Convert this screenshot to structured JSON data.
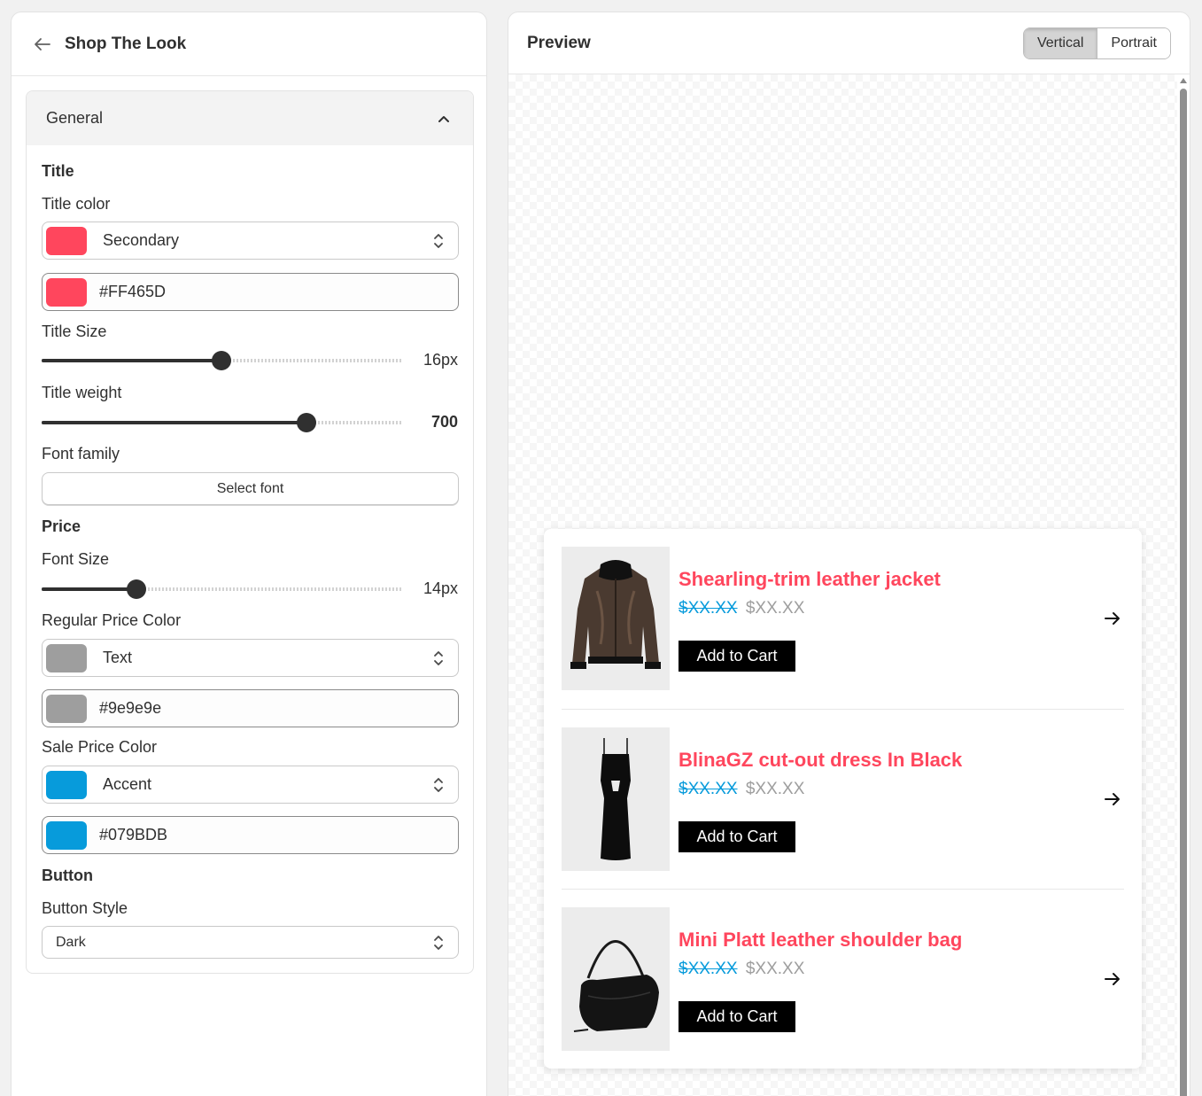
{
  "settings": {
    "header": {
      "title": "Shop The Look"
    },
    "accordion": {
      "label": "General"
    },
    "title_section": {
      "heading": "Title",
      "color_label": "Title color",
      "color_option": "Secondary",
      "color_swatch": "#FF465D",
      "color_hex": "#FF465D",
      "size_label": "Title Size",
      "size_value": "16px",
      "size_fraction": 0.5,
      "weight_label": "Title weight",
      "weight_value": "700",
      "weight_fraction": 0.735,
      "font_label": "Font family",
      "font_button": "Select font"
    },
    "price_section": {
      "heading": "Price",
      "size_label": "Font Size",
      "size_value": "14px",
      "size_fraction": 0.26,
      "regular_label": "Regular Price Color",
      "regular_option": "Text",
      "regular_swatch": "#9e9e9e",
      "regular_hex": "#9e9e9e",
      "sale_label": "Sale Price Color",
      "sale_option": "Accent",
      "sale_swatch": "#079BDB",
      "sale_hex": "#079BDB"
    },
    "button_section": {
      "heading": "Button",
      "style_label": "Button Style",
      "style_value": "Dark"
    }
  },
  "preview": {
    "title": "Preview",
    "layout_options": [
      "Vertical",
      "Portrait"
    ],
    "active_layout": "Vertical",
    "products": [
      {
        "title": "Shearling-trim leather jacket",
        "sale_price": "$XX.XX",
        "regular_price": "$XX.XX",
        "button": "Add to Cart",
        "image_icon": "jacket-image"
      },
      {
        "title": "BlinaGZ cut-out dress In Black",
        "sale_price": "$XX.XX",
        "regular_price": "$XX.XX",
        "button": "Add to Cart",
        "image_icon": "dress-image"
      },
      {
        "title": "Mini Platt leather shoulder bag",
        "sale_price": "$XX.XX",
        "regular_price": "$XX.XX",
        "button": "Add to Cart",
        "image_icon": "bag-image"
      }
    ]
  },
  "colors": {
    "title": "#FF465D",
    "regular_price": "#9e9e9e",
    "sale_price": "#079BDB",
    "button_bg": "#000000"
  }
}
